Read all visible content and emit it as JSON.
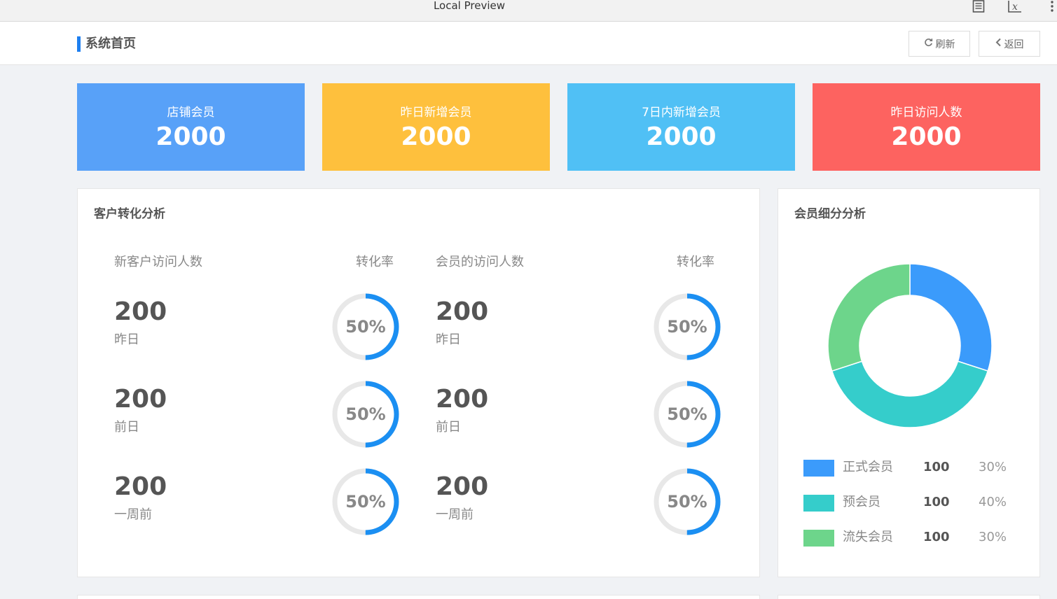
{
  "window": {
    "title": "Local Preview",
    "icons": [
      "document-icon",
      "formula-icon",
      "more-vertical-icon"
    ]
  },
  "header": {
    "title": "系统首页",
    "refresh_label": "刷新",
    "back_label": "返回"
  },
  "stats": [
    {
      "label": "店铺会员",
      "value": "2000",
      "color": "#58a1f8"
    },
    {
      "label": "昨日新增会员",
      "value": "2000",
      "color": "#fec03d"
    },
    {
      "label": "7日内新增会员",
      "value": "2000",
      "color": "#50c0f5"
    },
    {
      "label": "昨日访问人数",
      "value": "2000",
      "color": "#fd6360"
    }
  ],
  "conversion": {
    "title": "客户转化分析",
    "left": {
      "header": "新客户访问人数",
      "rate_header": "转化率",
      "rows": [
        {
          "value": "200",
          "period": "昨日",
          "rate": "50%",
          "fraction": 0.5
        },
        {
          "value": "200",
          "period": "前日",
          "rate": "50%",
          "fraction": 0.5
        },
        {
          "value": "200",
          "period": "一周前",
          "rate": "50%",
          "fraction": 0.5
        }
      ]
    },
    "right": {
      "header": "会员的访问人数",
      "rate_header": "转化率",
      "rows": [
        {
          "value": "200",
          "period": "昨日",
          "rate": "50%",
          "fraction": 0.5
        },
        {
          "value": "200",
          "period": "前日",
          "rate": "50%",
          "fraction": 0.5
        },
        {
          "value": "200",
          "period": "一周前",
          "rate": "50%",
          "fraction": 0.5
        }
      ]
    }
  },
  "segments": {
    "title": "会员细分分析",
    "items": [
      {
        "name": "正式会员",
        "count": "100",
        "percent": "30%",
        "share": 30,
        "color": "#3b9bfb"
      },
      {
        "name": "预会员",
        "count": "100",
        "percent": "40%",
        "share": 40,
        "color": "#35cdcb"
      },
      {
        "name": "流失会员",
        "count": "100",
        "percent": "30%",
        "share": 30,
        "color": "#6dd58b"
      }
    ]
  },
  "colors": {
    "accent": "#1e7ff0",
    "ring_fill": "#1b8ff2",
    "ring_track": "#e8e8e8"
  }
}
